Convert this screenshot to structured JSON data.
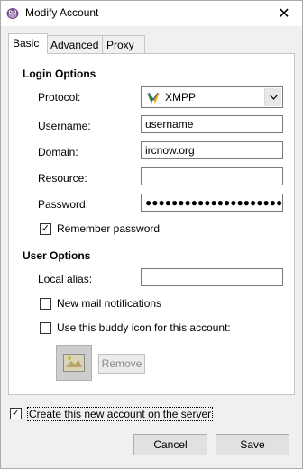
{
  "window": {
    "title": "Modify Account",
    "close_glyph": "✕"
  },
  "tabs": [
    {
      "label": "Basic",
      "active": true
    },
    {
      "label": "Advanced",
      "active": false
    },
    {
      "label": "Proxy",
      "active": false
    }
  ],
  "login_options": {
    "title": "Login Options",
    "protocol_label": "Protocol:",
    "protocol_value": "XMPP",
    "username_label": "Username:",
    "username_value": "username",
    "domain_label": "Domain:",
    "domain_value": "ircnow.org",
    "resource_label": "Resource:",
    "resource_value": "",
    "password_label": "Password:",
    "password_value": "●●●●●●●●●●●●●●●●●●●●●●●●●",
    "remember_label": "Remember password",
    "remember_checked": true
  },
  "user_options": {
    "title": "User Options",
    "alias_label": "Local alias:",
    "alias_value": "",
    "mail_label": "New mail notifications",
    "mail_checked": false,
    "buddy_icon_label": "Use this buddy icon for this account:",
    "buddy_icon_checked": false,
    "remove_label": "Remove"
  },
  "create_account": {
    "label": "Create this new account on the server",
    "checked": true
  },
  "buttons": {
    "cancel": "Cancel",
    "save": "Save"
  },
  "colors": {
    "window_bg": "#f0f0f0",
    "panel_bg": "#ffffff",
    "accent_green": "#3a7d22"
  },
  "icons": {
    "app": "pidgin-icon",
    "protocol": "xmpp-icon",
    "check": "✓"
  }
}
